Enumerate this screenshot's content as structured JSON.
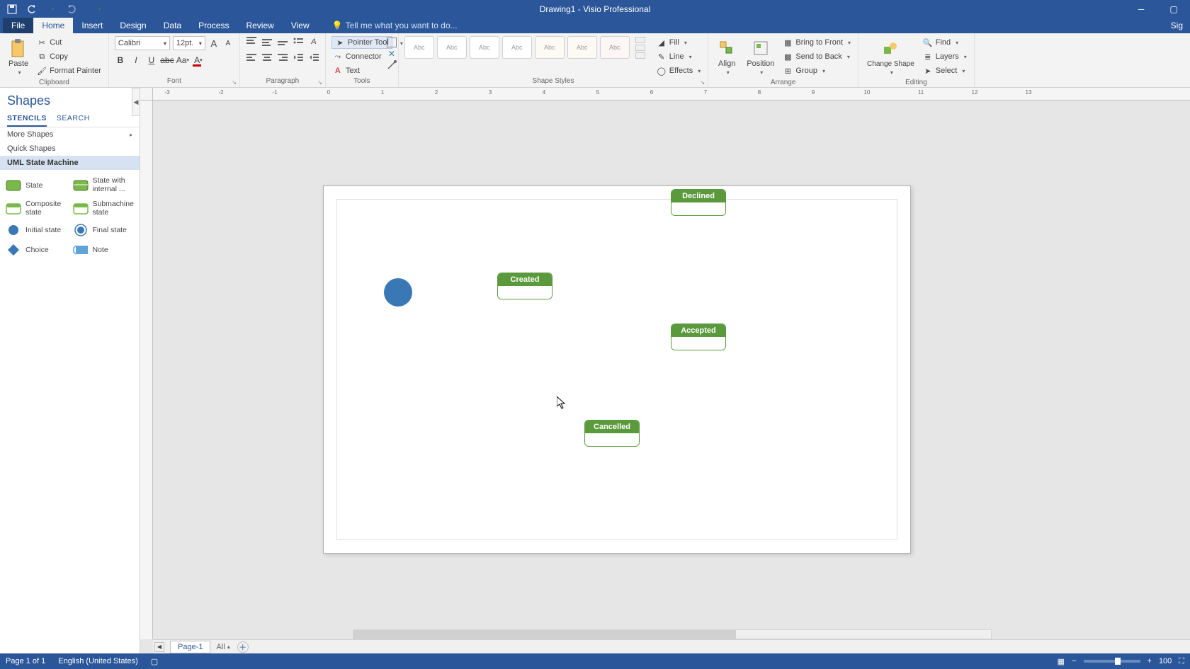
{
  "title": "Drawing1 - Visio Professional",
  "tabs": {
    "file": "File",
    "home": "Home",
    "insert": "Insert",
    "design": "Design",
    "data": "Data",
    "process": "Process",
    "review": "Review",
    "view": "View",
    "tell_me": "Tell me what you want to do...",
    "sign": "Sig"
  },
  "ribbon": {
    "clipboard": {
      "label": "Clipboard",
      "paste": "Paste",
      "cut": "Cut",
      "copy": "Copy",
      "format_painter": "Format Painter"
    },
    "font": {
      "label": "Font",
      "name": "Calibri",
      "size": "12pt."
    },
    "paragraph": {
      "label": "Paragraph"
    },
    "tools": {
      "label": "Tools",
      "pointer": "Pointer Tool",
      "connector": "Connector",
      "text": "Text"
    },
    "styles": {
      "label": "Shape Styles",
      "swatch": "Abc",
      "fill": "Fill",
      "line": "Line",
      "effects": "Effects"
    },
    "arrange": {
      "label": "Arrange",
      "align": "Align",
      "position": "Position",
      "change_shape": "Change Shape",
      "bring_front": "Bring to Front",
      "send_back": "Send to Back",
      "group": "Group"
    },
    "editing": {
      "label": "Editing",
      "find": "Find",
      "layers": "Layers",
      "select": "Select"
    }
  },
  "shapes_panel": {
    "title": "Shapes",
    "tab_stencils": "STENCILS",
    "tab_search": "SEARCH",
    "more": "More Shapes",
    "quick": "Quick Shapes",
    "stencil": "UML State Machine",
    "items": [
      {
        "label": "State"
      },
      {
        "label": "State with internal ..."
      },
      {
        "label": "Composite state"
      },
      {
        "label": "Submachine state"
      },
      {
        "label": "Initial state"
      },
      {
        "label": "Final state"
      },
      {
        "label": "Choice"
      },
      {
        "label": "Note"
      }
    ]
  },
  "canvas": {
    "ruler_marks": [
      "-3",
      "-2",
      "-1",
      "0",
      "1",
      "2",
      "3",
      "4",
      "5",
      "6",
      "7",
      "8",
      "9",
      "10",
      "11",
      "12",
      "13"
    ],
    "states": {
      "declined": "Declined",
      "created": "Created",
      "accepted": "Accepted",
      "cancelled": "Cancelled"
    }
  },
  "page_tabs": {
    "page1": "Page-1",
    "all": "All"
  },
  "status": {
    "page": "Page 1 of 1",
    "lang": "English (United States)",
    "zoom": "100"
  }
}
